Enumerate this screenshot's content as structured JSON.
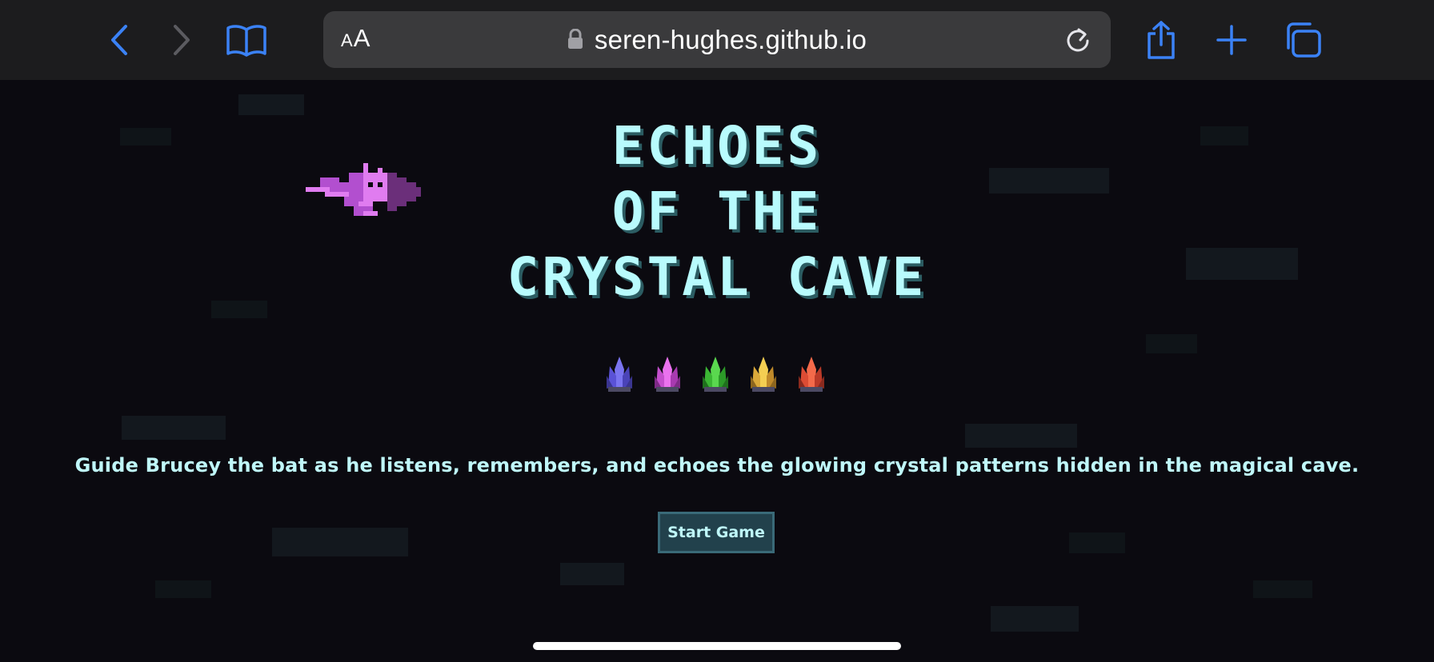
{
  "browser": {
    "reader_label_small": "A",
    "reader_label_big": "A",
    "url": "seren-hughes.github.io",
    "icons": {
      "back": "chevron-left-icon",
      "forward": "chevron-right-icon",
      "bookmarks": "book-icon",
      "lock": "lock-icon",
      "reload": "reload-icon",
      "share": "share-icon",
      "new_tab": "plus-icon",
      "tabs": "tabs-icon"
    },
    "accent_color": "#3b82f6"
  },
  "game": {
    "title_lines": [
      "ECHOES",
      "OF THE",
      "CRYSTAL CAVE"
    ],
    "crystals": [
      {
        "name": "blue-crystal-icon",
        "color": "#6c63e6"
      },
      {
        "name": "pink-crystal-icon",
        "color": "#d25ad8"
      },
      {
        "name": "green-crystal-icon",
        "color": "#3fbf3a"
      },
      {
        "name": "yellow-crystal-icon",
        "color": "#e2b23a"
      },
      {
        "name": "red-crystal-icon",
        "color": "#e0503a"
      }
    ],
    "tagline": "Guide Brucey the bat as he listens, remembers, and echoes the glowing crystal patterns hidden in the magical cave.",
    "start_button": "Start Game",
    "colors": {
      "title": "#b8fbfd",
      "background": "#0b0a10",
      "button_bg": "#22414c"
    }
  }
}
